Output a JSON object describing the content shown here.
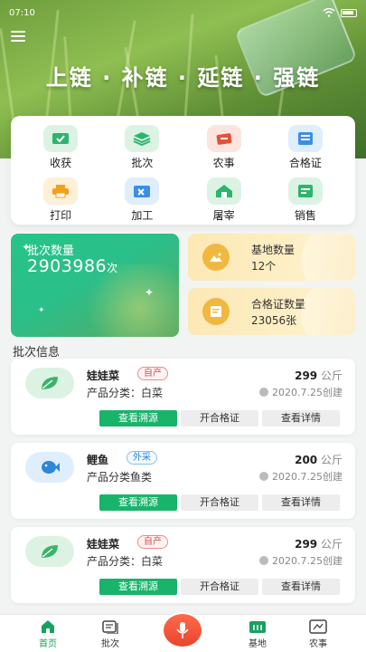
{
  "status_bar": {
    "time": "07:10"
  },
  "hero": {
    "slogan": "上链 · 补链 · 延链 · 强链"
  },
  "functions": [
    {
      "label": "收获",
      "icon": "harvest-icon",
      "color": "#2bb56d"
    },
    {
      "label": "批次",
      "icon": "batch-icon",
      "color": "#2bb56d"
    },
    {
      "label": "农事",
      "icon": "farm-work-icon",
      "color": "#e2523b"
    },
    {
      "label": "合格证",
      "icon": "certificate-icon",
      "color": "#3a8ee6"
    },
    {
      "label": "打印",
      "icon": "print-icon",
      "color": "#f0a020"
    },
    {
      "label": "加工",
      "icon": "process-icon",
      "color": "#3a8ee6"
    },
    {
      "label": "屠宰",
      "icon": "slaughter-icon",
      "color": "#2bb56d"
    },
    {
      "label": "销售",
      "icon": "sales-icon",
      "color": "#2bb56d"
    }
  ],
  "stats": {
    "batch_label": "批次数量",
    "batch_value": "2903986",
    "batch_unit": "次",
    "base_label": "基地数量",
    "base_value": "12个",
    "cert_label": "合格证数量",
    "cert_value": "23056张"
  },
  "section_title": "批次信息",
  "batches": [
    {
      "name": "娃娃菜",
      "tag": "自产",
      "tag_type": "red",
      "category": "产品分类：白菜",
      "weight": "299",
      "unit": "公斤",
      "date": "2020.7.25创建",
      "thumb": "leaf-icon"
    },
    {
      "name": "鲤鱼",
      "tag": "外采",
      "tag_type": "blue",
      "category": "产品分类鱼类",
      "weight": "200",
      "unit": "公斤",
      "date": "2020.7.25创建",
      "thumb": "fish-icon"
    },
    {
      "name": "娃娃菜",
      "tag": "自产",
      "tag_type": "red",
      "category": "产品分类：白菜",
      "weight": "299",
      "unit": "公斤",
      "date": "2020.7.25创建",
      "thumb": "leaf-icon"
    }
  ],
  "batch_buttons": {
    "trace": "查看溯源",
    "cert": "开合格证",
    "detail": "查看详情"
  },
  "nav": [
    {
      "label": "首页",
      "icon": "home-icon"
    },
    {
      "label": "批次",
      "icon": "batch-icon"
    },
    {
      "label": "基地",
      "icon": "base-icon"
    },
    {
      "label": "农事",
      "icon": "farm-work-icon"
    }
  ],
  "colors": {
    "primary": "#18b46a",
    "accent_red": "#e8452e"
  }
}
